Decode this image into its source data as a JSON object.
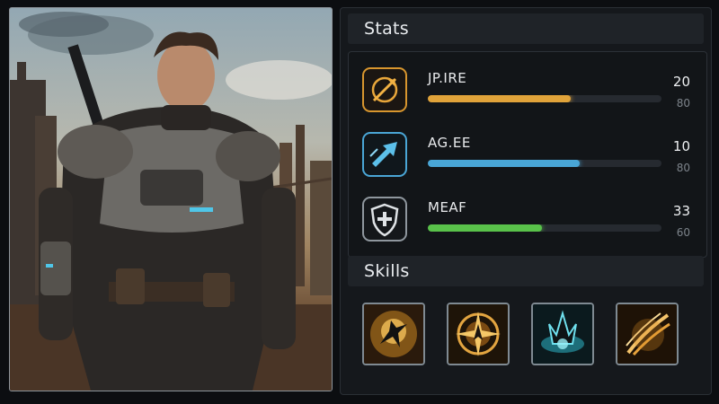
{
  "character": {
    "portrait_alt": "Armored soldier portrait"
  },
  "stats": {
    "title": "Stats",
    "items": [
      {
        "name": "JP.IRE",
        "value": "20",
        "max": "80",
        "fill": 0.61,
        "color": "#e0a33a",
        "icon": "arrow-target-icon"
      },
      {
        "name": "AG.EE",
        "value": "10",
        "max": "80",
        "fill": 0.65,
        "color": "#49a6d6",
        "icon": "dash-arrow-icon"
      },
      {
        "name": "MEAF",
        "value": "33",
        "max": "60",
        "fill": 0.49,
        "color": "#59c24a",
        "icon": "shield-cross-icon"
      }
    ]
  },
  "skills": {
    "title": "Skills",
    "items": [
      {
        "icon": "kick-strike-icon"
      },
      {
        "icon": "compass-star-icon"
      },
      {
        "icon": "frost-spike-icon"
      },
      {
        "icon": "claw-slash-icon"
      }
    ]
  },
  "colors": {
    "panel_bg": "#15181c",
    "header_bg": "#1f2328",
    "strength": "#e0a33a",
    "agility": "#49a6d6",
    "defense": "#59c24a"
  }
}
